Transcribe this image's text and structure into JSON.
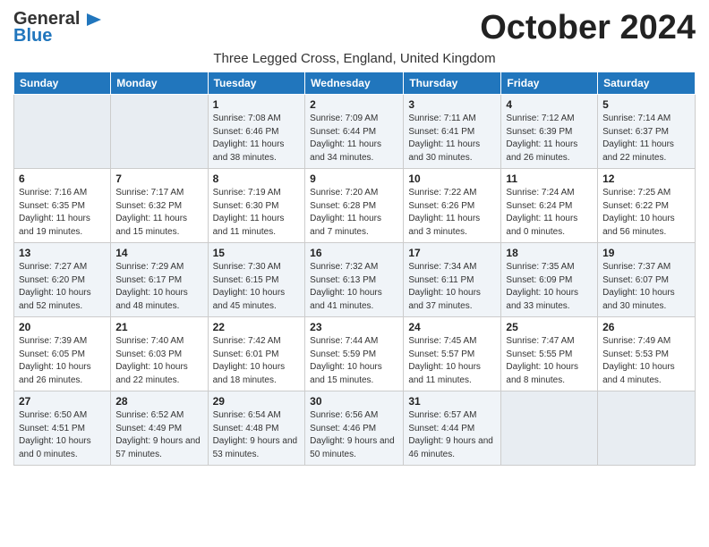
{
  "logo": {
    "line1": "General",
    "line2": "Blue",
    "icon": "▶"
  },
  "title": "October 2024",
  "subtitle": "Three Legged Cross, England, United Kingdom",
  "days_of_week": [
    "Sunday",
    "Monday",
    "Tuesday",
    "Wednesday",
    "Thursday",
    "Friday",
    "Saturday"
  ],
  "weeks": [
    [
      {
        "day": "",
        "info": ""
      },
      {
        "day": "",
        "info": ""
      },
      {
        "day": "1",
        "info": "Sunrise: 7:08 AM\nSunset: 6:46 PM\nDaylight: 11 hours and 38 minutes."
      },
      {
        "day": "2",
        "info": "Sunrise: 7:09 AM\nSunset: 6:44 PM\nDaylight: 11 hours and 34 minutes."
      },
      {
        "day": "3",
        "info": "Sunrise: 7:11 AM\nSunset: 6:41 PM\nDaylight: 11 hours and 30 minutes."
      },
      {
        "day": "4",
        "info": "Sunrise: 7:12 AM\nSunset: 6:39 PM\nDaylight: 11 hours and 26 minutes."
      },
      {
        "day": "5",
        "info": "Sunrise: 7:14 AM\nSunset: 6:37 PM\nDaylight: 11 hours and 22 minutes."
      }
    ],
    [
      {
        "day": "6",
        "info": "Sunrise: 7:16 AM\nSunset: 6:35 PM\nDaylight: 11 hours and 19 minutes."
      },
      {
        "day": "7",
        "info": "Sunrise: 7:17 AM\nSunset: 6:32 PM\nDaylight: 11 hours and 15 minutes."
      },
      {
        "day": "8",
        "info": "Sunrise: 7:19 AM\nSunset: 6:30 PM\nDaylight: 11 hours and 11 minutes."
      },
      {
        "day": "9",
        "info": "Sunrise: 7:20 AM\nSunset: 6:28 PM\nDaylight: 11 hours and 7 minutes."
      },
      {
        "day": "10",
        "info": "Sunrise: 7:22 AM\nSunset: 6:26 PM\nDaylight: 11 hours and 3 minutes."
      },
      {
        "day": "11",
        "info": "Sunrise: 7:24 AM\nSunset: 6:24 PM\nDaylight: 11 hours and 0 minutes."
      },
      {
        "day": "12",
        "info": "Sunrise: 7:25 AM\nSunset: 6:22 PM\nDaylight: 10 hours and 56 minutes."
      }
    ],
    [
      {
        "day": "13",
        "info": "Sunrise: 7:27 AM\nSunset: 6:20 PM\nDaylight: 10 hours and 52 minutes."
      },
      {
        "day": "14",
        "info": "Sunrise: 7:29 AM\nSunset: 6:17 PM\nDaylight: 10 hours and 48 minutes."
      },
      {
        "day": "15",
        "info": "Sunrise: 7:30 AM\nSunset: 6:15 PM\nDaylight: 10 hours and 45 minutes."
      },
      {
        "day": "16",
        "info": "Sunrise: 7:32 AM\nSunset: 6:13 PM\nDaylight: 10 hours and 41 minutes."
      },
      {
        "day": "17",
        "info": "Sunrise: 7:34 AM\nSunset: 6:11 PM\nDaylight: 10 hours and 37 minutes."
      },
      {
        "day": "18",
        "info": "Sunrise: 7:35 AM\nSunset: 6:09 PM\nDaylight: 10 hours and 33 minutes."
      },
      {
        "day": "19",
        "info": "Sunrise: 7:37 AM\nSunset: 6:07 PM\nDaylight: 10 hours and 30 minutes."
      }
    ],
    [
      {
        "day": "20",
        "info": "Sunrise: 7:39 AM\nSunset: 6:05 PM\nDaylight: 10 hours and 26 minutes."
      },
      {
        "day": "21",
        "info": "Sunrise: 7:40 AM\nSunset: 6:03 PM\nDaylight: 10 hours and 22 minutes."
      },
      {
        "day": "22",
        "info": "Sunrise: 7:42 AM\nSunset: 6:01 PM\nDaylight: 10 hours and 18 minutes."
      },
      {
        "day": "23",
        "info": "Sunrise: 7:44 AM\nSunset: 5:59 PM\nDaylight: 10 hours and 15 minutes."
      },
      {
        "day": "24",
        "info": "Sunrise: 7:45 AM\nSunset: 5:57 PM\nDaylight: 10 hours and 11 minutes."
      },
      {
        "day": "25",
        "info": "Sunrise: 7:47 AM\nSunset: 5:55 PM\nDaylight: 10 hours and 8 minutes."
      },
      {
        "day": "26",
        "info": "Sunrise: 7:49 AM\nSunset: 5:53 PM\nDaylight: 10 hours and 4 minutes."
      }
    ],
    [
      {
        "day": "27",
        "info": "Sunrise: 6:50 AM\nSunset: 4:51 PM\nDaylight: 10 hours and 0 minutes."
      },
      {
        "day": "28",
        "info": "Sunrise: 6:52 AM\nSunset: 4:49 PM\nDaylight: 9 hours and 57 minutes."
      },
      {
        "day": "29",
        "info": "Sunrise: 6:54 AM\nSunset: 4:48 PM\nDaylight: 9 hours and 53 minutes."
      },
      {
        "day": "30",
        "info": "Sunrise: 6:56 AM\nSunset: 4:46 PM\nDaylight: 9 hours and 50 minutes."
      },
      {
        "day": "31",
        "info": "Sunrise: 6:57 AM\nSunset: 4:44 PM\nDaylight: 9 hours and 46 minutes."
      },
      {
        "day": "",
        "info": ""
      },
      {
        "day": "",
        "info": ""
      }
    ]
  ]
}
